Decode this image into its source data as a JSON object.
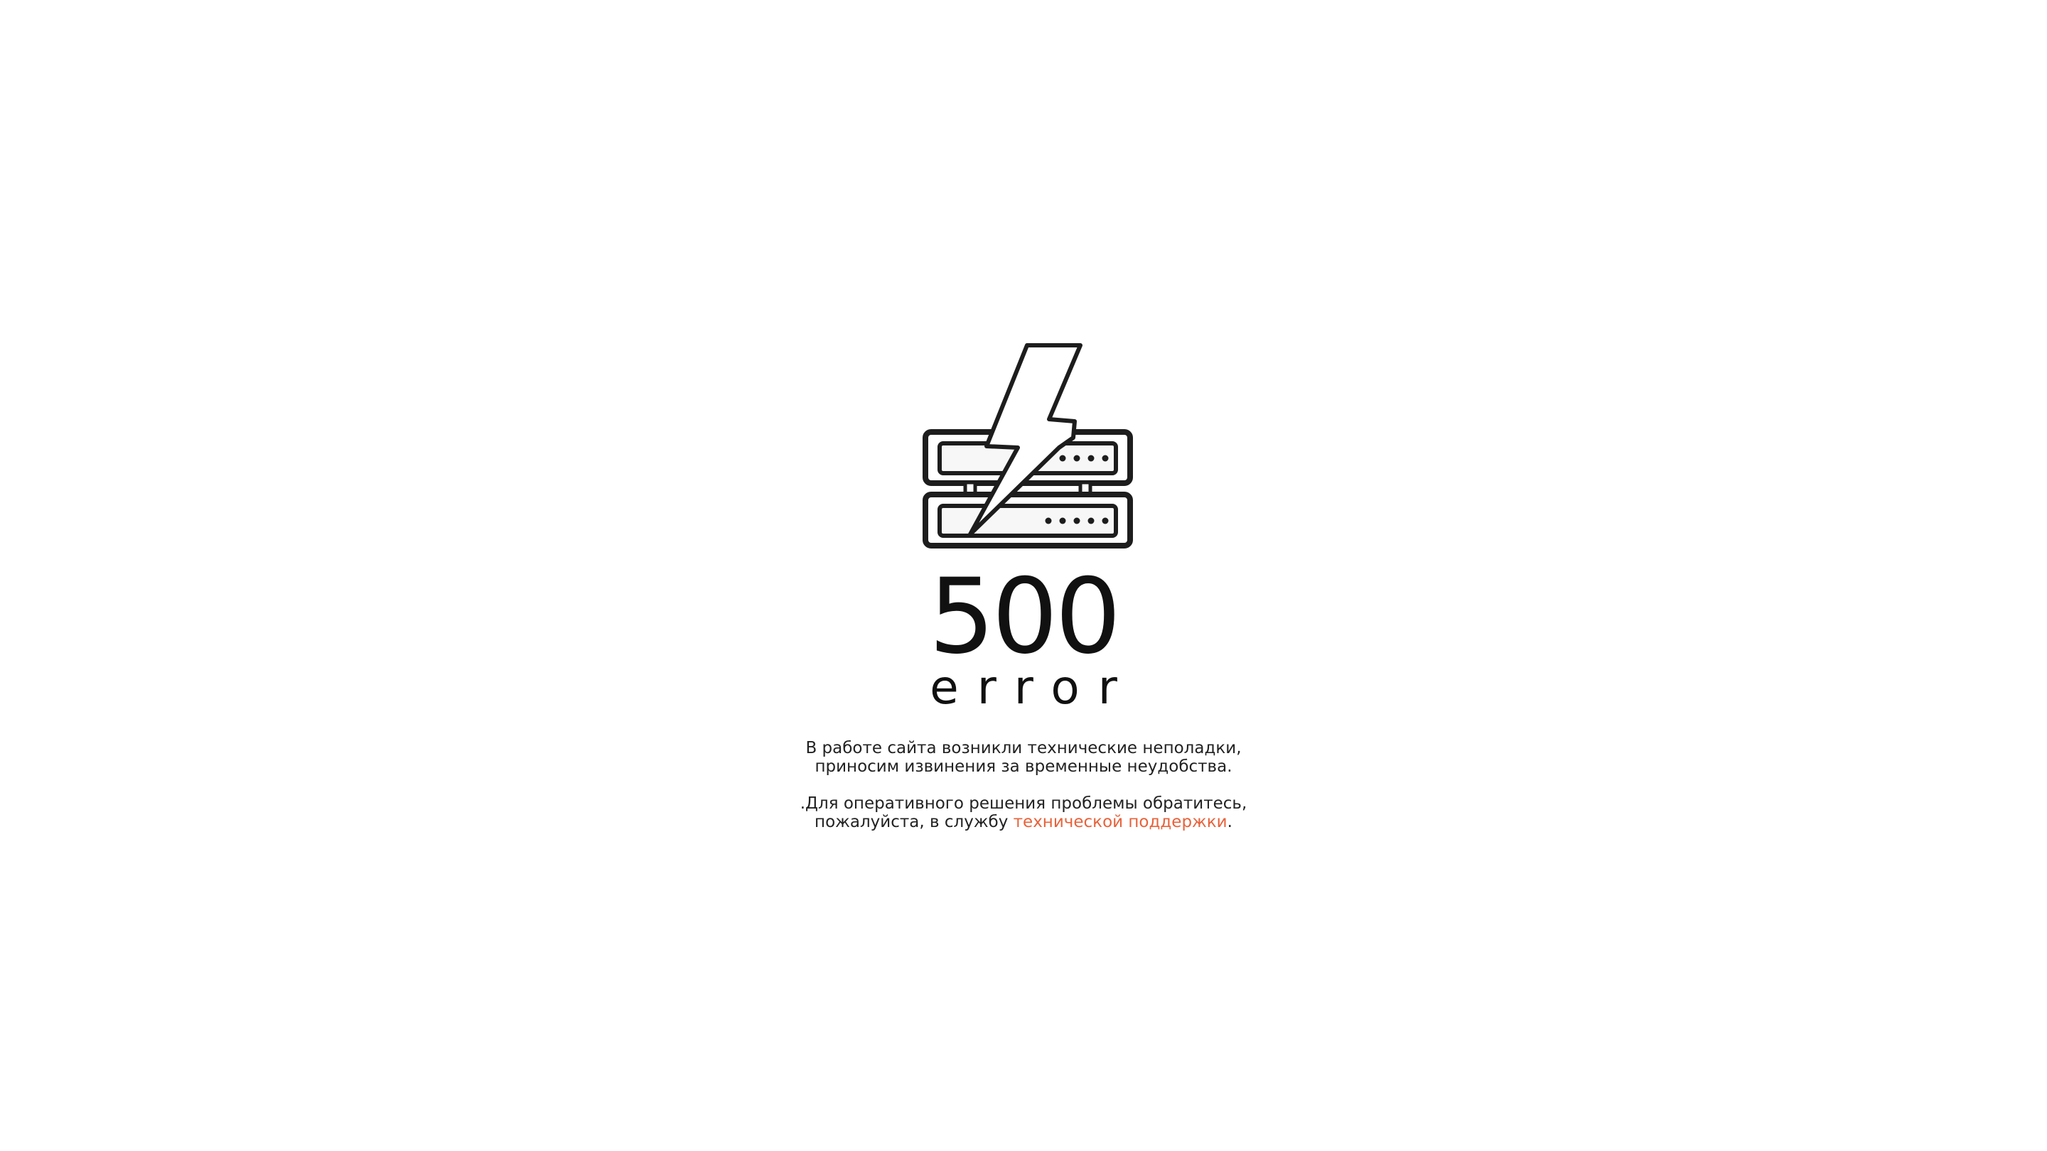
{
  "error": {
    "code": "500",
    "label": "error"
  },
  "message": {
    "line1": "В работе сайта возникли технические неполадки,",
    "line2": "приносим извинения за временные неудобства.",
    "line3": ".Для оперативного решения проблемы обратитесь,",
    "line4_prefix": "пожалуйста, в службу ",
    "support_link_text": "технической поддержки",
    "line4_suffix": "."
  },
  "colors": {
    "accent_link": "#e8623a",
    "text": "#222222",
    "icon_stroke": "#1d1d1d"
  },
  "icons": {
    "illustration": "server-lightning-icon"
  }
}
